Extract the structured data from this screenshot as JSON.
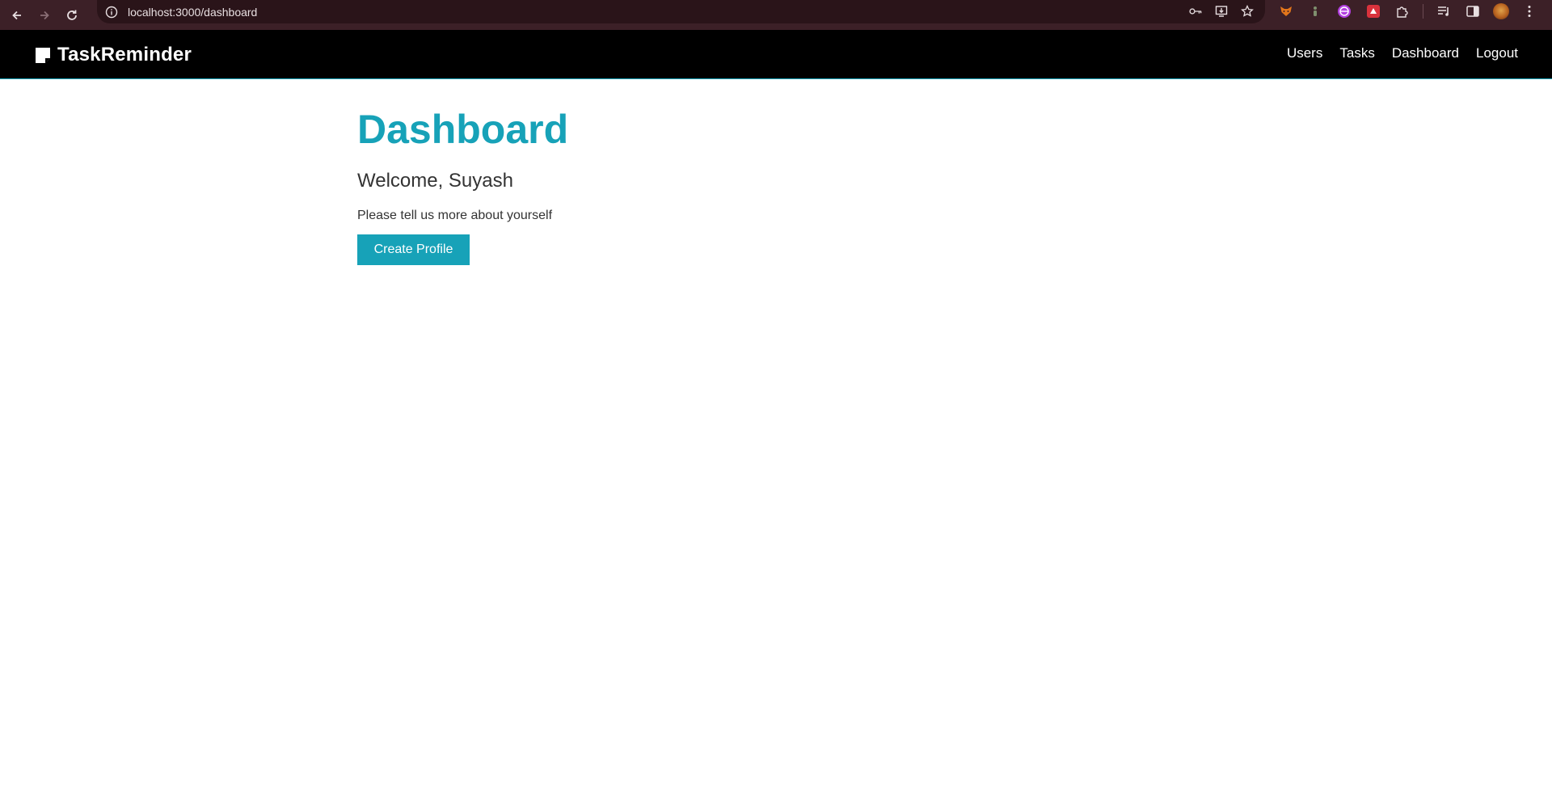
{
  "browser": {
    "url": "localhost:3000/dashboard",
    "back_icon": "arrow-left-icon",
    "forward_icon": "arrow-right-icon",
    "reload_icon": "reload-icon",
    "colors": {
      "frame": "#3c2027",
      "omnibox": "#2a1419"
    }
  },
  "navbar": {
    "brand": "TaskReminder",
    "brand_icon": "sticky-note-icon",
    "links": {
      "users": "Users",
      "tasks": "Tasks",
      "dashboard": "Dashboard",
      "logout": "Logout"
    },
    "colors": {
      "background": "#000000",
      "accent": "#17a2b8"
    }
  },
  "main": {
    "title": "Dashboard",
    "welcome": "Welcome, Suyash",
    "prompt": "Please tell us more about yourself",
    "create_profile_label": "Create Profile",
    "colors": {
      "accent": "#17a2b8",
      "text": "#333333"
    }
  }
}
